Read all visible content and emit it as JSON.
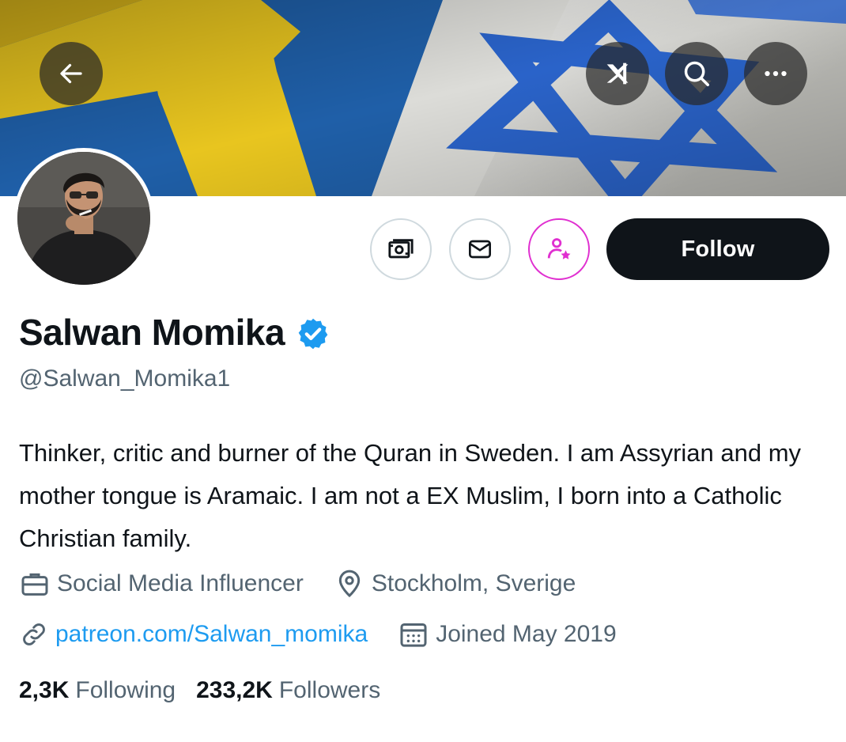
{
  "header": {
    "back_icon": "arrow-left-icon",
    "grok_icon": "grok-icon",
    "search_icon": "search-icon",
    "more_icon": "more-dots-icon"
  },
  "profile": {
    "display_name": "Salwan Momika",
    "handle": "@Salwan_Momika1",
    "verified": true,
    "bio": "Thinker, critic and burner of the Quran in Sweden. I am Assyrian and my mother tongue is Aramaic. I am not a EX Muslim, I born into a Catholic Christian family.",
    "profession": "Social Media Influencer",
    "location": "Stockholm, Sverige",
    "website": "patreon.com/Salwan_momika",
    "joined": "Joined May 2019"
  },
  "actions": {
    "tip_icon": "money-icon",
    "message_icon": "envelope-icon",
    "subscribe_icon": "person-star-icon",
    "follow_label": "Follow"
  },
  "stats": {
    "following_count": "2,3K",
    "following_label": "Following",
    "followers_count": "233,2K",
    "followers_label": "Followers"
  },
  "colors": {
    "link": "#1d9bf0",
    "verified": "#1d9bf0",
    "subscribe_accent": "#e02fd0",
    "muted_text": "#536471",
    "follow_button": "#0f1419"
  }
}
